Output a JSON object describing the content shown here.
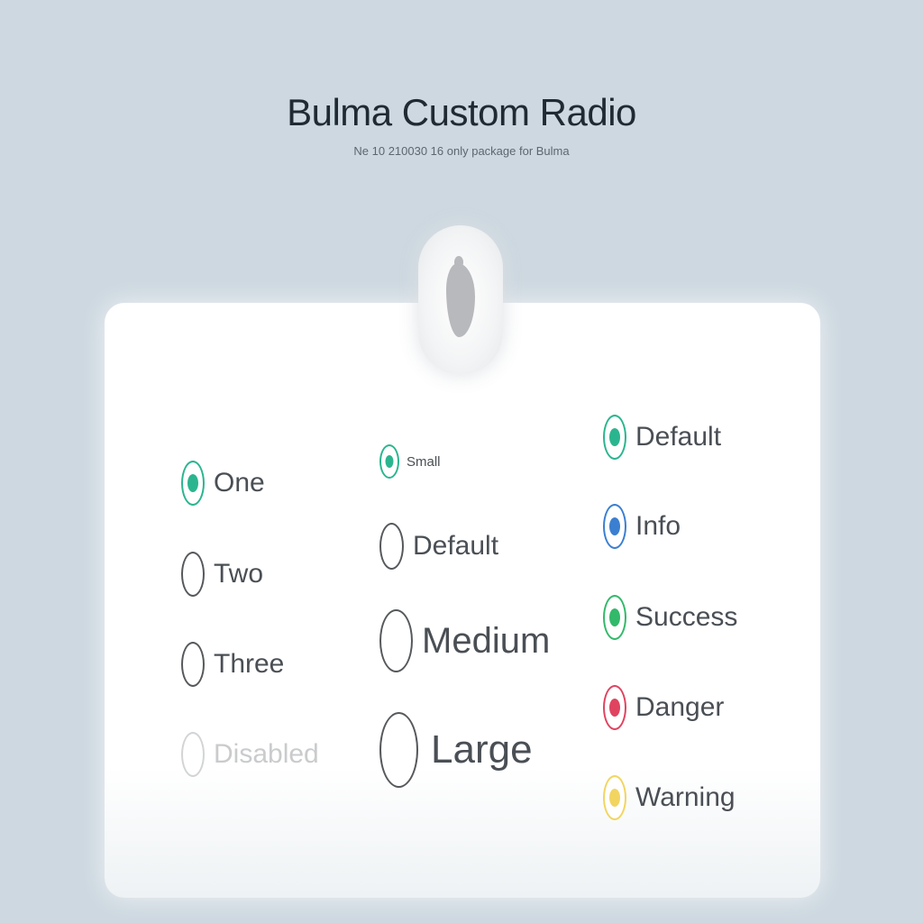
{
  "header": {
    "title": "Bulma Custom Radio",
    "subtitle": "Ne 10 210030 16 only package for Bulma"
  },
  "icons": {
    "logo": "bulma-logo-icon"
  },
  "basic_radios": {
    "items": [
      {
        "label": "One",
        "checked": true,
        "disabled": false
      },
      {
        "label": "Two",
        "checked": false,
        "disabled": false
      },
      {
        "label": "Three",
        "checked": false,
        "disabled": false
      },
      {
        "label": "Disabled",
        "checked": false,
        "disabled": true
      }
    ]
  },
  "size_radios": {
    "items": [
      {
        "label": "Small",
        "checked": true,
        "size": "small"
      },
      {
        "label": "Default",
        "checked": false,
        "size": "default"
      },
      {
        "label": "Medium",
        "checked": false,
        "size": "medium"
      },
      {
        "label": "Large",
        "checked": false,
        "size": "large"
      }
    ]
  },
  "color_radios": {
    "items": [
      {
        "label": "Default",
        "checked": true,
        "color": "#2bb58f"
      },
      {
        "label": "Info",
        "checked": true,
        "color": "#3b7fd1"
      },
      {
        "label": "Success",
        "checked": true,
        "color": "#32b96a"
      },
      {
        "label": "Danger",
        "checked": true,
        "color": "#e0435f"
      },
      {
        "label": "Warning",
        "checked": true,
        "color": "#f2d560"
      }
    ]
  },
  "colors": {
    "background": "#cdd8e0",
    "card": "#ffffff",
    "primary": "#2bb58f"
  }
}
